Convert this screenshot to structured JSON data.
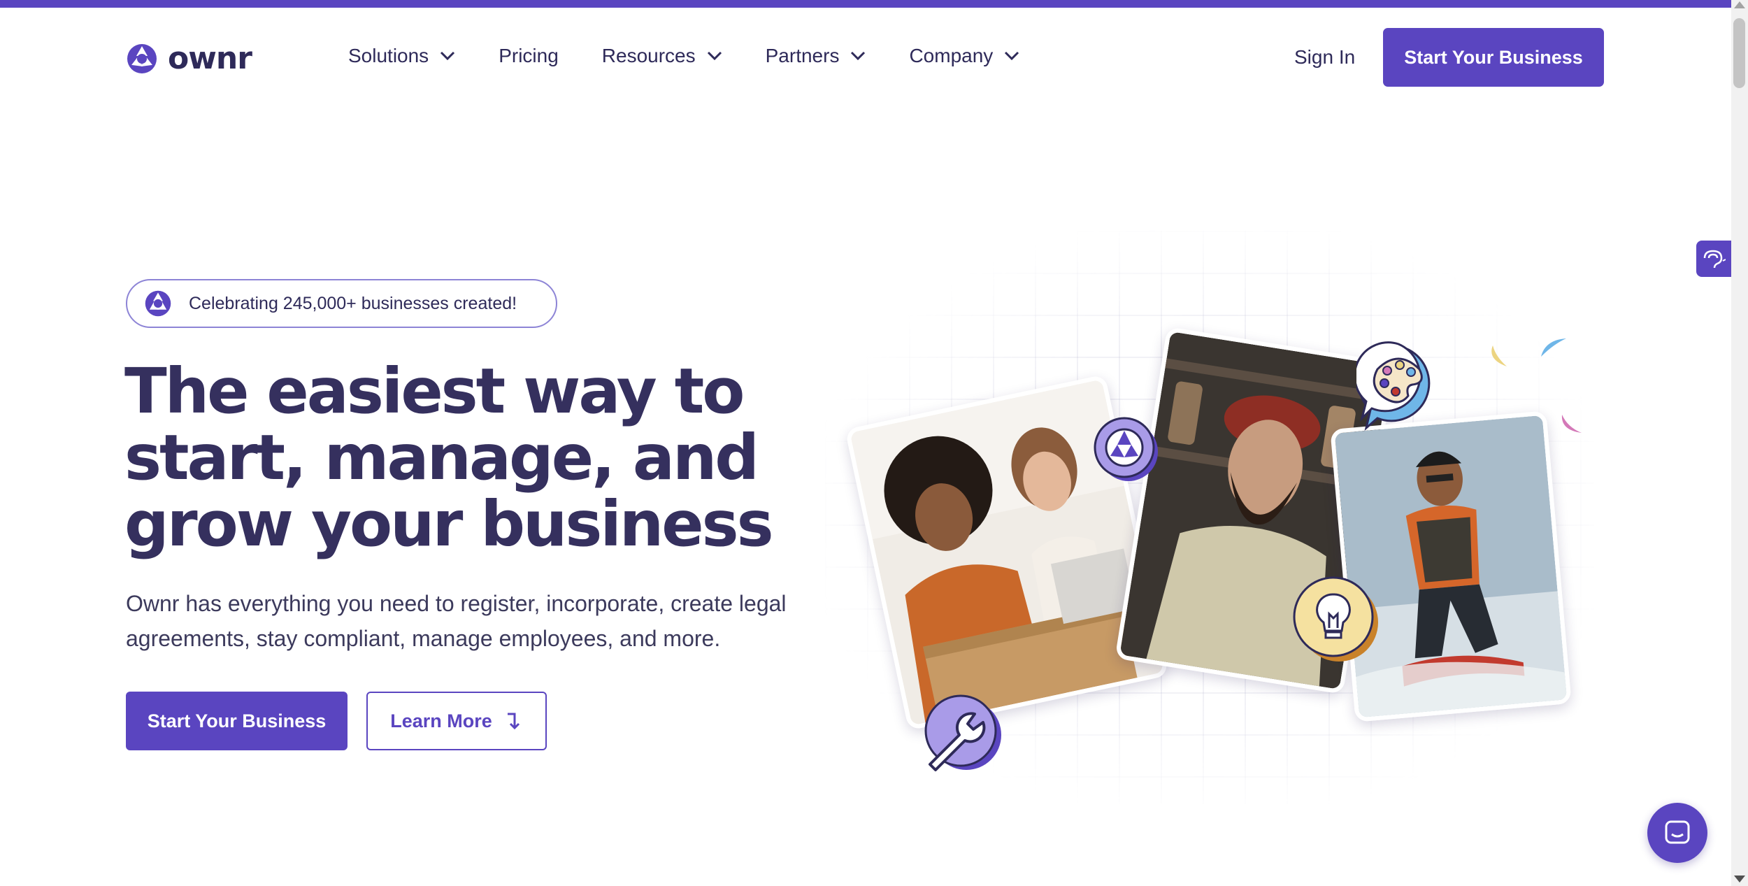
{
  "brand": {
    "name": "ownr",
    "accent_color": "#5a45c0",
    "heading_color": "#35305e"
  },
  "nav": {
    "items": [
      {
        "label": "Solutions",
        "has_dropdown": true
      },
      {
        "label": "Pricing",
        "has_dropdown": false
      },
      {
        "label": "Resources",
        "has_dropdown": true
      },
      {
        "label": "Partners",
        "has_dropdown": true
      },
      {
        "label": "Company",
        "has_dropdown": true
      }
    ],
    "sign_in": "Sign In",
    "cta": "Start Your Business"
  },
  "hero": {
    "badge": "Celebrating 245,000+ businesses created!",
    "headline_lines": [
      "The easiest way to",
      "start, manage, and",
      "grow your business"
    ],
    "subtext_lines": [
      "Ownr has everything you need to register, incorporate, create legal",
      "agreements, stay compliant, manage employees, and more."
    ],
    "primary_cta": "Start Your Business",
    "secondary_cta": "Learn More",
    "secondary_cta_icon": "arrow-down-right-icon"
  },
  "illustration": {
    "icons": [
      "ownr-logo-badge-icon",
      "palette-icon",
      "lightbulb-icon",
      "wrench-icon"
    ],
    "photos": [
      "two-women-packing-boxes",
      "bearded-man-in-shop",
      "man-jet-surfing"
    ]
  },
  "widgets": {
    "side_tab_icon": "accessibility-ear-icon",
    "chat_icon": "chat-icon"
  }
}
